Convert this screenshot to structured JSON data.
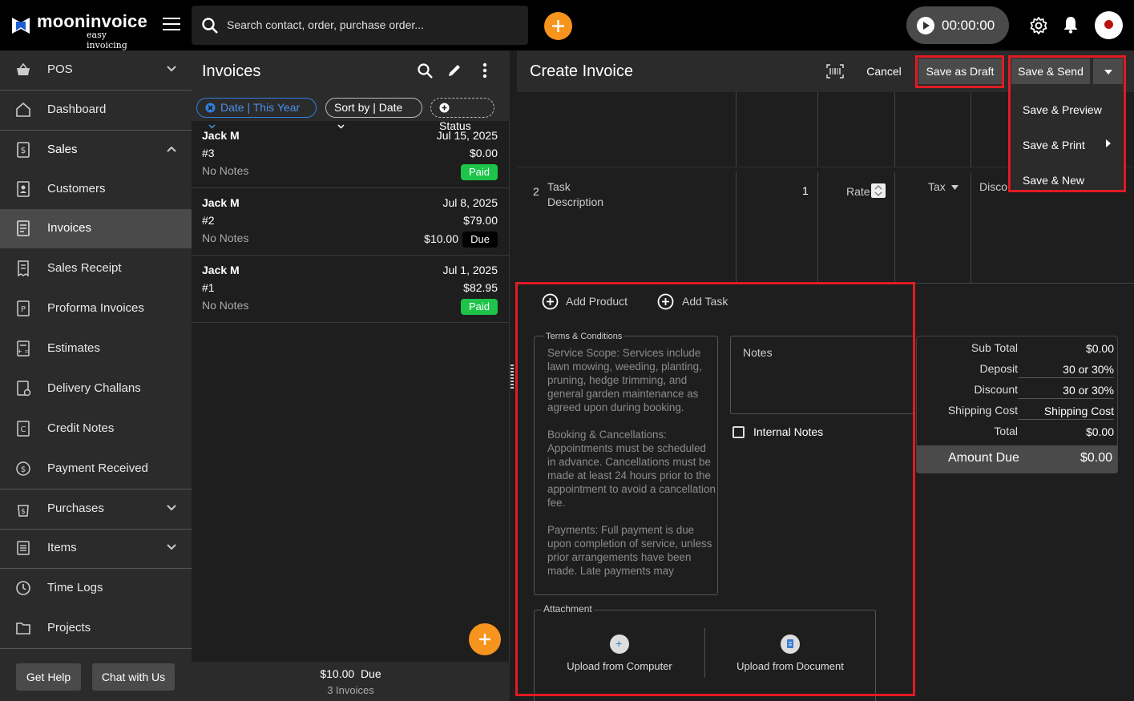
{
  "app": {
    "logo_name": "mooninvoice",
    "logo_tagline": "easy invoicing",
    "search_placeholder": "Search contact, order, purchase order...",
    "timer": "00:00:00",
    "accent_color": "#f7941d"
  },
  "sidebar": {
    "items": [
      {
        "label": "POS",
        "icon": "basket-icon"
      },
      {
        "label": "Dashboard",
        "icon": "home-icon"
      },
      {
        "label": "Sales",
        "icon": "dollar-doc-icon"
      },
      {
        "label": "Customers",
        "icon": "contact-book-icon"
      },
      {
        "label": "Invoices",
        "icon": "invoice-icon"
      },
      {
        "label": "Sales Receipt",
        "icon": "receipt-icon"
      },
      {
        "label": "Proforma Invoices",
        "icon": "proforma-icon"
      },
      {
        "label": "Estimates",
        "icon": "calculator-icon"
      },
      {
        "label": "Delivery Challans",
        "icon": "delivery-doc-icon"
      },
      {
        "label": "Credit Notes",
        "icon": "credit-note-icon"
      },
      {
        "label": "Payment Received",
        "icon": "payment-icon"
      },
      {
        "label": "Purchases",
        "icon": "purchase-icon"
      },
      {
        "label": "Items",
        "icon": "items-list-icon"
      },
      {
        "label": "Time Logs",
        "icon": "clock-icon"
      },
      {
        "label": "Projects",
        "icon": "folder-icon"
      }
    ],
    "get_help": "Get Help",
    "chat": "Chat with Us"
  },
  "list": {
    "title": "Invoices",
    "filter_date": "Date | This Year",
    "filter_sort": "Sort by | Date",
    "filter_status": "Status",
    "rows": [
      {
        "name": "Jack M",
        "date": "Jul 15, 2025",
        "number": "#3",
        "amount": "$0.00",
        "notes": "No Notes",
        "status": "Paid",
        "due_amount": ""
      },
      {
        "name": "Jack M",
        "date": "Jul 8, 2025",
        "number": "#2",
        "amount": "$79.00",
        "notes": "No Notes",
        "status": "Due",
        "due_amount": "$10.00"
      },
      {
        "name": "Jack M",
        "date": "Jul 1, 2025",
        "number": "#1",
        "amount": "$82.95",
        "notes": "No Notes",
        "status": "Paid",
        "due_amount": ""
      }
    ],
    "footer_due": "$10.00  Due",
    "footer_count": "3 Invoices"
  },
  "editor": {
    "title": "Create Invoice",
    "cancel": "Cancel",
    "save_draft": "Save as Draft",
    "save_send": "Save & Send",
    "menu": [
      "Save & Preview",
      "Save & Print",
      "Save & New"
    ],
    "line": {
      "index": "2",
      "task": "Task",
      "description": "Description",
      "qty": "1",
      "rate": "Rate",
      "tax": "Tax",
      "discount": "Disco..."
    },
    "add_product": "Add Product",
    "add_task": "Add Task",
    "terms_label": "Terms & Conditions",
    "terms_text": "Service Scope: Services include lawn mowing, weeding, planting, pruning, hedge trimming, and general garden maintenance as agreed upon during booking.\n\nBooking & Cancellations: Appointments must be scheduled in advance. Cancellations must be made at least 24 hours prior to the appointment to avoid a cancellation fee.\n\nPayments: Full payment is due upon completion of service, unless prior arrangements have been made. Late payments may",
    "notes_label": "Notes",
    "internal_notes": "Internal Notes",
    "attachment_label": "Attachment",
    "upload_computer": "Upload from Computer",
    "upload_document": "Upload from Document",
    "totals": [
      {
        "label": "Sub Total",
        "value": "$0.00"
      },
      {
        "label": "Deposit",
        "value": "30 or 30%"
      },
      {
        "label": "Discount",
        "value": "30 or 30%"
      },
      {
        "label": "Shipping Cost",
        "value": "Shipping Cost"
      },
      {
        "label": "Total",
        "value": "$0.00"
      }
    ],
    "amount_due_label": "Amount Due",
    "amount_due_value": "$0.00",
    "highlight_color": "#e01b24"
  }
}
